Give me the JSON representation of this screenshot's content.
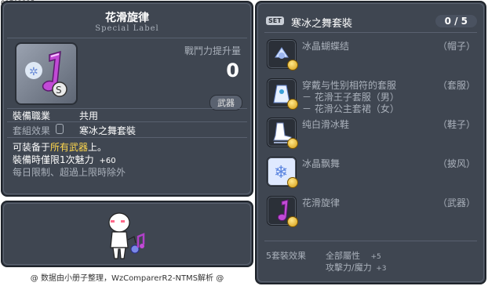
{
  "item_id": "01703325",
  "item": {
    "name": "花滑旋律",
    "subtitle": "Special Label",
    "power_label": "戰鬥力提升量",
    "power_value": "0",
    "category_badge": "武器",
    "job_label": "裝備職業",
    "job_value": "共用",
    "set_label": "套組效果",
    "set_value": "寒冰之舞套裝",
    "desc_prefix": "可装备于",
    "desc_highlight": "所有武器",
    "desc_suffix": "上。",
    "bonus_label": "裝備時僅限1次魅力",
    "bonus_value": "+60",
    "limit_text": "每日限制、超過上限時除外"
  },
  "footer_text": "@ 数据由小册子整理，WzComparerR2-NTMS解析 @",
  "set_panel": {
    "badge": "SET",
    "title": "寒冰之舞套裝",
    "count": "0 / 5",
    "items": [
      {
        "name": "冰晶蝴蝶结",
        "slot": "（帽子）",
        "lines": []
      },
      {
        "name": "穿戴与性别相符的套服",
        "slot": "（套服）",
        "lines": [
          "－ 花滑王子套服（男）",
          "－ 花滑公主套裙（女）"
        ]
      },
      {
        "name": "纯白滑冰鞋",
        "slot": "（鞋子）",
        "lines": []
      },
      {
        "name": "冰晶飘舞",
        "slot": "（披风）",
        "lines": []
      },
      {
        "name": "花滑旋律",
        "slot": "（武器）",
        "lines": []
      }
    ],
    "effect_label": "5套裝效果",
    "effects": [
      {
        "name": "全部屬性",
        "value": "+5"
      },
      {
        "name": "攻擊力/魔力",
        "value": "+3"
      }
    ]
  },
  "colors": {
    "panel_bg": "#3f4651",
    "highlight": "#ffd84d",
    "badge_bg": "#4a5260"
  }
}
